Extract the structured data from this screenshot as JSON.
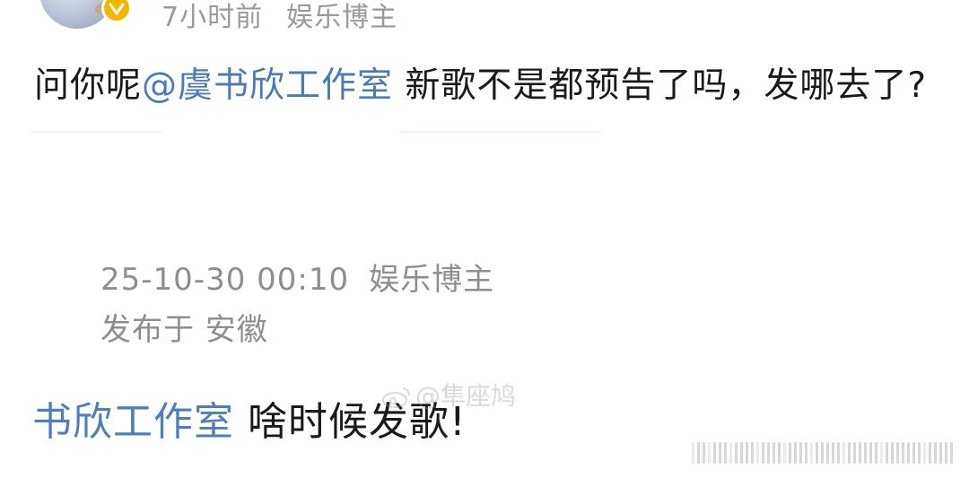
{
  "post": {
    "time_ago": "7小时前",
    "author_tag": "娱乐博主",
    "text_prefix": "问你呢",
    "mention": "@虞书欣工作室",
    "text_suffix": " 新歌不是都预告了吗，发哪去了?"
  },
  "quote": {
    "timestamp": "25-10-30 00:10",
    "author_tag": "娱乐博主",
    "location": "发布于 安徽",
    "comment_author": "书欣工作室",
    "comment_text": " 啥时候发歌!"
  },
  "watermark": {
    "text": "@隼座鸠"
  },
  "colors": {
    "mention_blue": "#4a7bb5",
    "meta_gray": "#9a9a9a",
    "badge_gold": "#f7b500"
  },
  "icons": [
    "verified-icon",
    "weibo-logo-icon"
  ]
}
